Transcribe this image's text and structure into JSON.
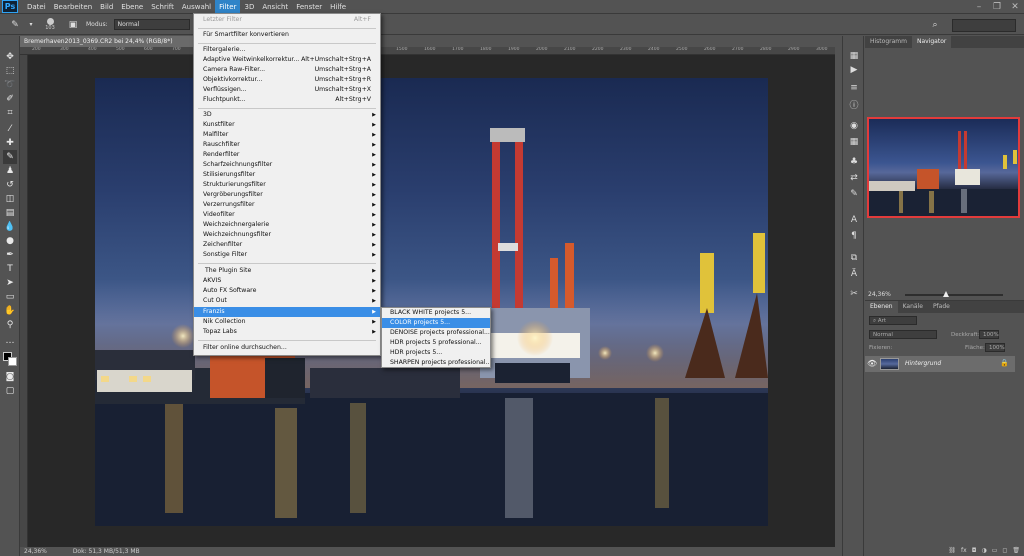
{
  "app": {
    "logo": "Ps"
  },
  "menubar": {
    "items": [
      "Datei",
      "Bearbeiten",
      "Bild",
      "Ebene",
      "Schrift",
      "Auswahl",
      "Filter",
      "3D",
      "Ansicht",
      "Fenster",
      "Hilfe"
    ],
    "active_index": 6
  },
  "options_bar": {
    "brush_size": "103",
    "mode_label": "Modus:",
    "mode_value": "Normal"
  },
  "document": {
    "tab_title": "Bremerhaven2013_0369.CR2 bei 24,4% (RGB/8*)",
    "close": "×",
    "ruler_ticks": [
      "200",
      "300",
      "400",
      "500",
      "600",
      "700",
      "800",
      "900",
      "1000",
      "1100",
      "1200",
      "1300",
      "1400",
      "1500",
      "1600",
      "1700",
      "1800",
      "1900",
      "2000",
      "2100",
      "2200",
      "2300",
      "2400",
      "2500",
      "2600",
      "2700",
      "2800",
      "2900",
      "3000"
    ],
    "zoom": "24,36%",
    "status": "Dok: 51,3 MB/51,3 MB"
  },
  "filter_menu": {
    "last_filter": {
      "label": "Letzter Filter",
      "shortcut": "Alt+F"
    },
    "smart_filter": "Für Smartfilter konvertieren",
    "group1": [
      {
        "label": "Filtergalerie...",
        "shortcut": ""
      },
      {
        "label": "Adaptive Weitwinkelkorrektur...",
        "shortcut": "Alt+Umschalt+Strg+A"
      },
      {
        "label": "Camera Raw-Filter...",
        "shortcut": "Umschalt+Strg+A"
      },
      {
        "label": "Objektivkorrektur...",
        "shortcut": "Umschalt+Strg+R"
      },
      {
        "label": "Verflüssigen...",
        "shortcut": "Umschalt+Strg+X"
      },
      {
        "label": "Fluchtpunkt...",
        "shortcut": "Alt+Strg+V"
      }
    ],
    "group2": [
      "3D",
      "Kunstfilter",
      "Malfilter",
      "Rauschfilter",
      "Renderfilter",
      "Scharfzeichnungsfilter",
      "Stilisierungsfilter",
      "Strukturierungsfilter",
      "Vergröberungsfilter",
      "Verzerrungsfilter",
      "Videofilter",
      "Weichzeichnergalerie",
      "Weichzeichnungsfilter",
      "Zeichenfilter",
      "Sonstige Filter"
    ],
    "group3": [
      "The Plugin Site",
      "AKVIS",
      "Auto FX Software",
      "Cut Out",
      "Franzis",
      "Nik Collection",
      "Topaz Labs"
    ],
    "group3_highlight_index": 4,
    "online": "Filter online durchsuchen..."
  },
  "franzis_submenu": {
    "items": [
      "BLACK WHITE projects 5...",
      "COLOR projects 5...",
      "DENOISE projects professional...",
      "HDR projects 5 professional...",
      "HDR projects 5...",
      "SHARPEN projects professional..."
    ],
    "highlight_index": 1
  },
  "navigator_panel": {
    "tabs": [
      "Histogramm",
      "Navigator"
    ],
    "active_tab": 1,
    "zoom": "24,36%",
    "slider_level": 0.45
  },
  "layers_panel": {
    "tabs": [
      "Ebenen",
      "Kanäle",
      "Pfade"
    ],
    "active_tab": 0,
    "filter_label": "Art",
    "blend_mode": "Normal",
    "opacity_label": "Deckkraft:",
    "opacity_value": "100%",
    "lock_label": "Fixieren:",
    "fill_label": "Fläche:",
    "fill_value": "100%",
    "layer_name": "Hintergrund"
  }
}
